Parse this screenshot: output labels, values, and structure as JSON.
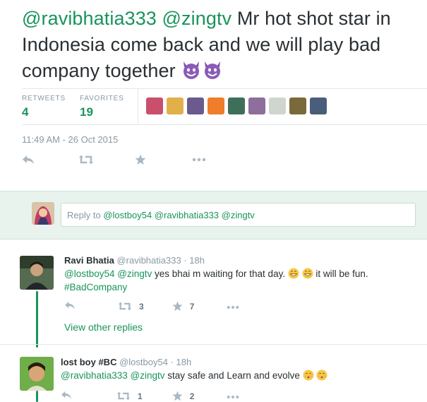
{
  "tweet": {
    "mention1": "@ravibhatia333",
    "mention2": "@zingtv",
    "text": "Mr hot shot star in Indonesia come back and we will play bad company together",
    "emoji": "smiling-imp-emoji"
  },
  "stats": {
    "retweets_label": "RETWEETS",
    "retweets_count": "4",
    "favorites_label": "FAVORITES",
    "favorites_count": "19"
  },
  "favoriters": [
    {
      "name": "favoriter-avatar-1",
      "color": "#c94f6d"
    },
    {
      "name": "favoriter-avatar-2",
      "color": "#e2b04a"
    },
    {
      "name": "favoriter-avatar-3",
      "color": "#6b5a8e"
    },
    {
      "name": "favoriter-avatar-4",
      "color": "#f07d2b"
    },
    {
      "name": "favoriter-avatar-5",
      "color": "#3f6f59"
    },
    {
      "name": "favoriter-avatar-6",
      "color": "#8d6e9c"
    },
    {
      "name": "favoriter-avatar-7",
      "color": "#cfd6d0"
    },
    {
      "name": "favoriter-avatar-8",
      "color": "#7a6a3a"
    },
    {
      "name": "favoriter-avatar-9",
      "color": "#4a5d7a"
    }
  ],
  "timestamp": "11:49 AM - 26 Oct 2015",
  "reply_box": {
    "prefix": "Reply to",
    "mentions": "@lostboy54 @ravibhatia333 @zingtv"
  },
  "replies": [
    {
      "name": "Ravi Bhatia",
      "handle": "@ravibhatia333",
      "time": "· 18h",
      "mentions": "@lostboy54 @zingtv",
      "text": "yes bhai m waiting for that day.",
      "text2": "it will be fun.",
      "hashtag": "#BadCompany",
      "retweets": "3",
      "favorites": "7"
    },
    {
      "name": "lost boy #BC",
      "handle": "@lostboy54",
      "time": "· 18h",
      "mentions": "@ravibhatia333 @zingtv",
      "text": "stay safe and Learn and evolve",
      "retweets": "1",
      "favorites": "2"
    }
  ],
  "view_other_replies": "View other replies",
  "colors": {
    "accent": "#19945b",
    "reply_bar_bg": "#e8f3ee",
    "muted": "#8899a6"
  }
}
